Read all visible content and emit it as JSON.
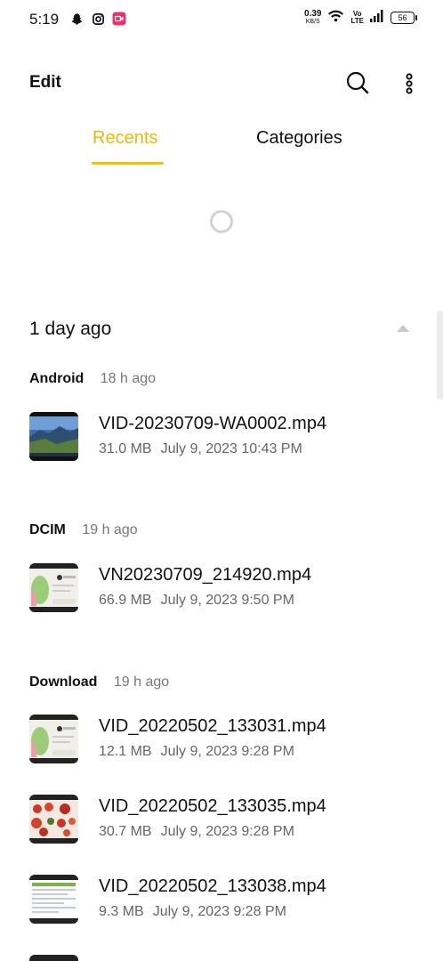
{
  "status_bar": {
    "time": "5:19",
    "speed_value": "0.39",
    "speed_unit": "KB/S",
    "volte_top": "Vo",
    "volte_bottom": "LTE",
    "battery": "56",
    "icons": [
      "snapchat-icon",
      "instagram-icon",
      "screen-recorder-icon",
      "wifi-icon",
      "volte-icon",
      "signal-icon",
      "battery-icon"
    ]
  },
  "app_bar": {
    "edit_label": "Edit",
    "icons": [
      "search-icon",
      "more-vertical-icon"
    ]
  },
  "tabs": [
    {
      "label": "Recents",
      "active": true
    },
    {
      "label": "Categories",
      "active": false
    }
  ],
  "accent_color": "#f2b705",
  "section": {
    "title": "1 day ago"
  },
  "groups": [
    {
      "name": "Android",
      "time": "18 h ago",
      "files": [
        {
          "name": "VID-20230709-WA0002.mp4",
          "size": "31.0 MB",
          "date": "July 9, 2023 10:43 PM"
        }
      ]
    },
    {
      "name": "DCIM",
      "time": "19 h ago",
      "files": [
        {
          "name": "VN20230709_214920.mp4",
          "size": "66.9 MB",
          "date": "July 9, 2023 9:50 PM"
        }
      ]
    },
    {
      "name": "Download",
      "time": "19 h ago",
      "files": [
        {
          "name": "VID_20220502_133031.mp4",
          "size": "12.1 MB",
          "date": "July 9, 2023 9:28 PM"
        },
        {
          "name": "VID_20220502_133035.mp4",
          "size": "30.7 MB",
          "date": "July 9, 2023 9:28 PM"
        },
        {
          "name": "VID_20220502_133038.mp4",
          "size": "9.3 MB",
          "date": "July 9, 2023 9:28 PM"
        }
      ]
    }
  ]
}
